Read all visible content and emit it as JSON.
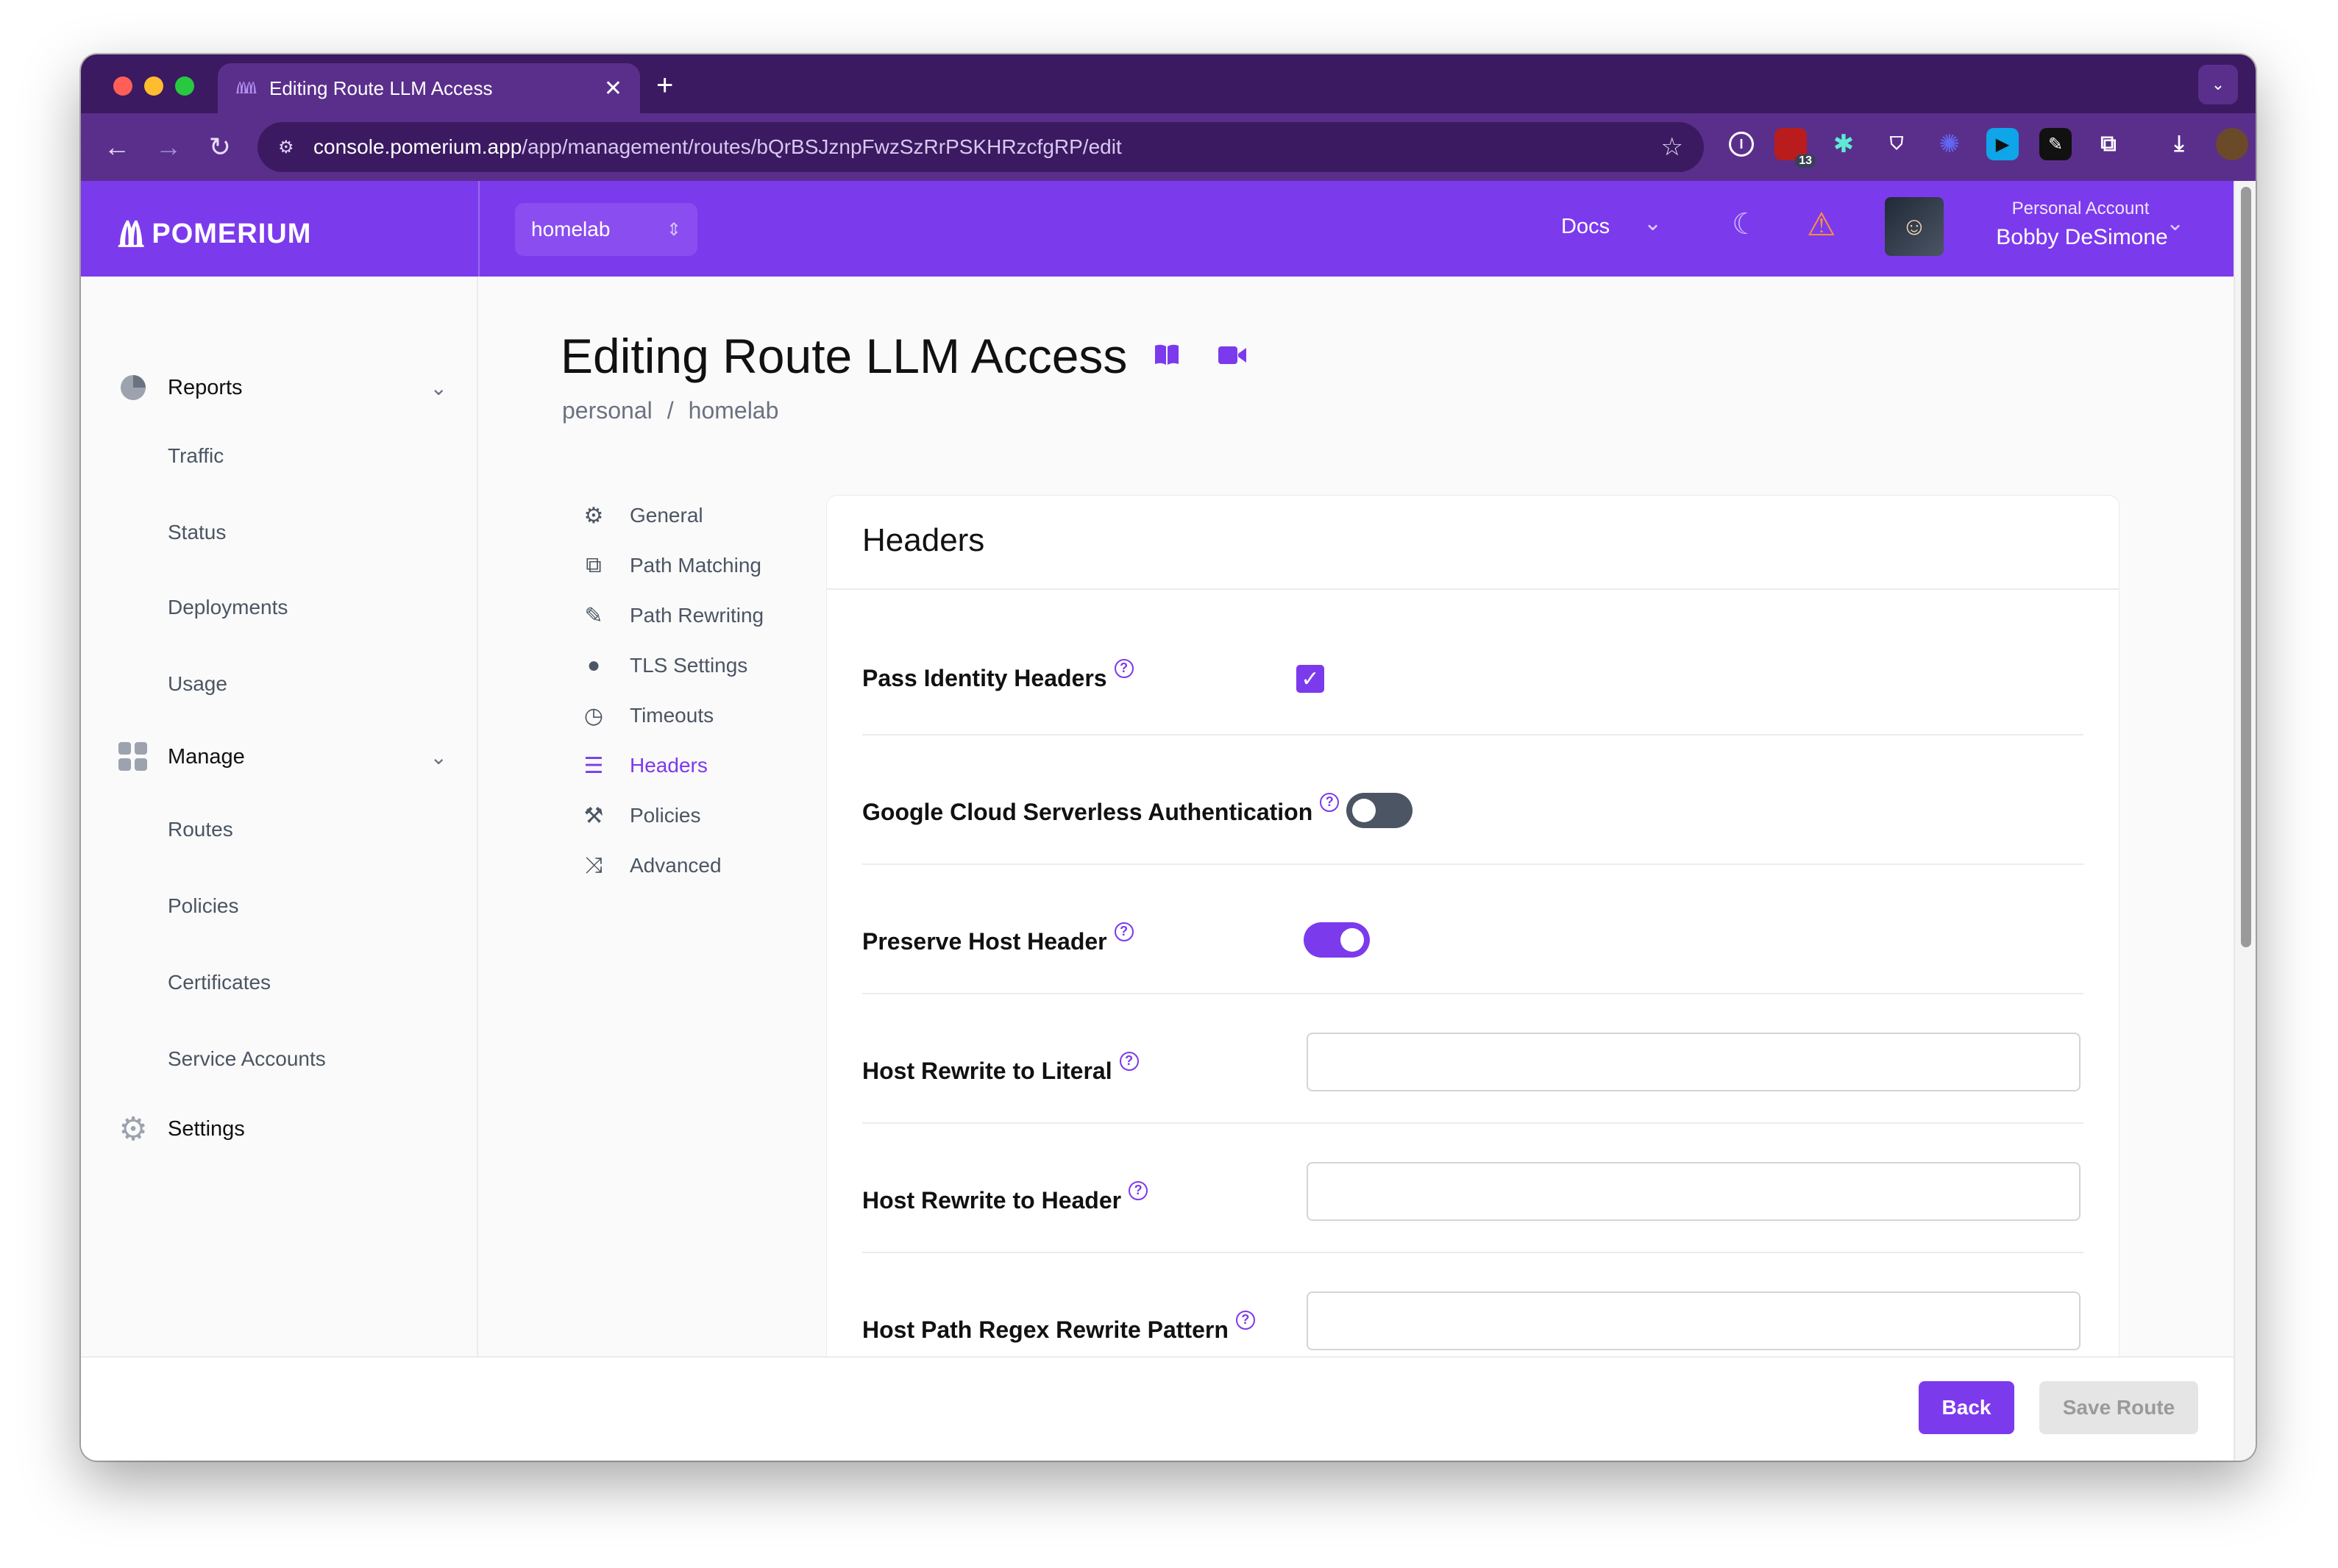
{
  "browser": {
    "tab_title": "Editing Route LLM Access",
    "url_host": "console.pomerium.app",
    "url_path": "/app/management/routes/bQrBSJznpFwzSzRrPSKHRzcfgRP/edit",
    "extension_badge": "13"
  },
  "header": {
    "brand": "POMERIUM",
    "cluster": "homelab",
    "docs_label": "Docs",
    "account_label": "Personal Account",
    "user_name": "Bobby DeSimone"
  },
  "sidebar": {
    "groups": [
      {
        "label": "Reports",
        "icon": "pie-chart-icon",
        "items": [
          "Traffic",
          "Status",
          "Deployments",
          "Usage"
        ]
      },
      {
        "label": "Manage",
        "icon": "grid-icon",
        "items": [
          "Routes",
          "Policies",
          "Certificates",
          "Service Accounts"
        ]
      },
      {
        "label": "Settings",
        "icon": "gear-icon",
        "items": []
      }
    ]
  },
  "page": {
    "title": "Editing Route LLM Access",
    "breadcrumb": [
      "personal",
      "homelab"
    ],
    "breadcrumb_sep": "/"
  },
  "subnav": {
    "items": [
      {
        "label": "General",
        "icon": "gear-icon"
      },
      {
        "label": "Path Matching",
        "icon": "copy-icon"
      },
      {
        "label": "Path Rewriting",
        "icon": "pencil-icon"
      },
      {
        "label": "TLS Settings",
        "icon": "user-icon"
      },
      {
        "label": "Timeouts",
        "icon": "clock-icon"
      },
      {
        "label": "Headers",
        "icon": "list-icon"
      },
      {
        "label": "Policies",
        "icon": "gavel-icon"
      },
      {
        "label": "Advanced",
        "icon": "shuffle-icon"
      }
    ],
    "active": "Headers"
  },
  "form": {
    "section_title": "Headers",
    "fields": [
      {
        "label": "Pass Identity Headers",
        "type": "checkbox",
        "checked": true
      },
      {
        "label": "Google Cloud Serverless Authentication",
        "type": "toggle",
        "on": false
      },
      {
        "label": "Preserve Host Header",
        "type": "toggle",
        "on": true
      },
      {
        "label": "Host Rewrite to Literal",
        "type": "text",
        "value": ""
      },
      {
        "label": "Host Rewrite to Header",
        "type": "text",
        "value": ""
      },
      {
        "label": "Host Path Regex Rewrite Pattern",
        "type": "text",
        "value": ""
      }
    ]
  },
  "footer": {
    "back_label": "Back",
    "save_label": "Save Route"
  },
  "colors": {
    "brand_purple": "#7c3aed",
    "chrome_dark": "#3b1a61",
    "chrome_mid": "#5a2f8c",
    "warning": "#fb923c"
  }
}
